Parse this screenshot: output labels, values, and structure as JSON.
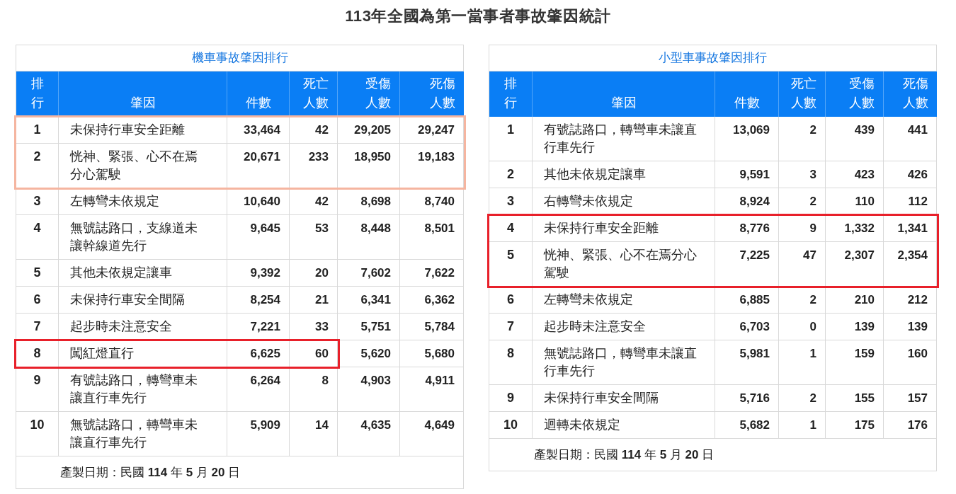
{
  "title": "113年全國為第一當事者事故肇因統計",
  "tables": [
    {
      "caption": "機車事故肇因排行",
      "columns": [
        "排行",
        "肇因",
        "件數",
        "死亡人數",
        "受傷人數",
        "死傷人數"
      ],
      "rows": [
        {
          "cells": [
            "1",
            "未保持行車安全距離",
            "33,464",
            "42",
            "29,205",
            "29,247"
          ],
          "highlight": {
            "color": "#f5b5a0",
            "partial": false
          }
        },
        {
          "cells": [
            "2",
            "恍神、緊張、心不在焉分心駕駛",
            "20,671",
            "233",
            "18,950",
            "19,183"
          ],
          "highlight": {
            "color": "#f5b5a0",
            "partial": false
          }
        },
        {
          "cells": [
            "3",
            "左轉彎未依規定",
            "10,640",
            "42",
            "8,698",
            "8,740"
          ]
        },
        {
          "cells": [
            "4",
            "無號誌路口，支線道未讓幹線道先行",
            "9,645",
            "53",
            "8,448",
            "8,501"
          ]
        },
        {
          "cells": [
            "5",
            "其他未依規定讓車",
            "9,392",
            "20",
            "7,602",
            "7,622"
          ]
        },
        {
          "cells": [
            "6",
            "未保持行車安全間隔",
            "8,254",
            "21",
            "6,341",
            "6,362"
          ]
        },
        {
          "cells": [
            "7",
            "起步時未注意安全",
            "7,221",
            "33",
            "5,751",
            "5,784"
          ]
        },
        {
          "cells": [
            "8",
            "闖紅燈直行",
            "6,625",
            "60",
            "5,620",
            "5,680"
          ],
          "highlight": {
            "color": "#e8202a",
            "partial": true
          }
        },
        {
          "cells": [
            "9",
            "有號誌路口，轉彎車未讓直行車先行",
            "6,264",
            "8",
            "4,903",
            "4,911"
          ]
        },
        {
          "cells": [
            "10",
            "無號誌路口，轉彎車未讓直行車先行",
            "5,909",
            "14",
            "4,635",
            "4,649"
          ]
        }
      ],
      "footer": "產製日期：民國 **114** 年 **5** 月 **20** 日"
    },
    {
      "caption": "小型車事故肇因排行",
      "columns": [
        "排行",
        "肇因",
        "件數",
        "死亡人數",
        "受傷人數",
        "死傷人數"
      ],
      "rows": [
        {
          "cells": [
            "1",
            "有號誌路口，轉彎車未讓直行車先行",
            "13,069",
            "2",
            "439",
            "441"
          ]
        },
        {
          "cells": [
            "2",
            "其他未依規定讓車",
            "9,591",
            "3",
            "423",
            "426"
          ]
        },
        {
          "cells": [
            "3",
            "右轉彎未依規定",
            "8,924",
            "2",
            "110",
            "112"
          ]
        },
        {
          "cells": [
            "4",
            "未保持行車安全距離",
            "8,776",
            "9",
            "1,332",
            "1,341"
          ],
          "highlight": {
            "color": "#e8202a",
            "partial": false
          }
        },
        {
          "cells": [
            "5",
            "恍神、緊張、心不在焉分心駕駛",
            "7,225",
            "47",
            "2,307",
            "2,354"
          ],
          "highlight": {
            "color": "#e8202a",
            "partial": false
          }
        },
        {
          "cells": [
            "6",
            "左轉彎未依規定",
            "6,885",
            "2",
            "210",
            "212"
          ]
        },
        {
          "cells": [
            "7",
            "起步時未注意安全",
            "6,703",
            "0",
            "139",
            "139"
          ]
        },
        {
          "cells": [
            "8",
            "無號誌路口，轉彎車未讓直行車先行",
            "5,981",
            "1",
            "159",
            "160"
          ]
        },
        {
          "cells": [
            "9",
            "未保持行車安全間隔",
            "5,716",
            "2",
            "155",
            "157"
          ]
        },
        {
          "cells": [
            "10",
            "迴轉未依規定",
            "5,682",
            "1",
            "175",
            "176"
          ]
        }
      ],
      "footer": "產製日期：民國 **114** 年 **5** 月 **20** 日"
    }
  ]
}
